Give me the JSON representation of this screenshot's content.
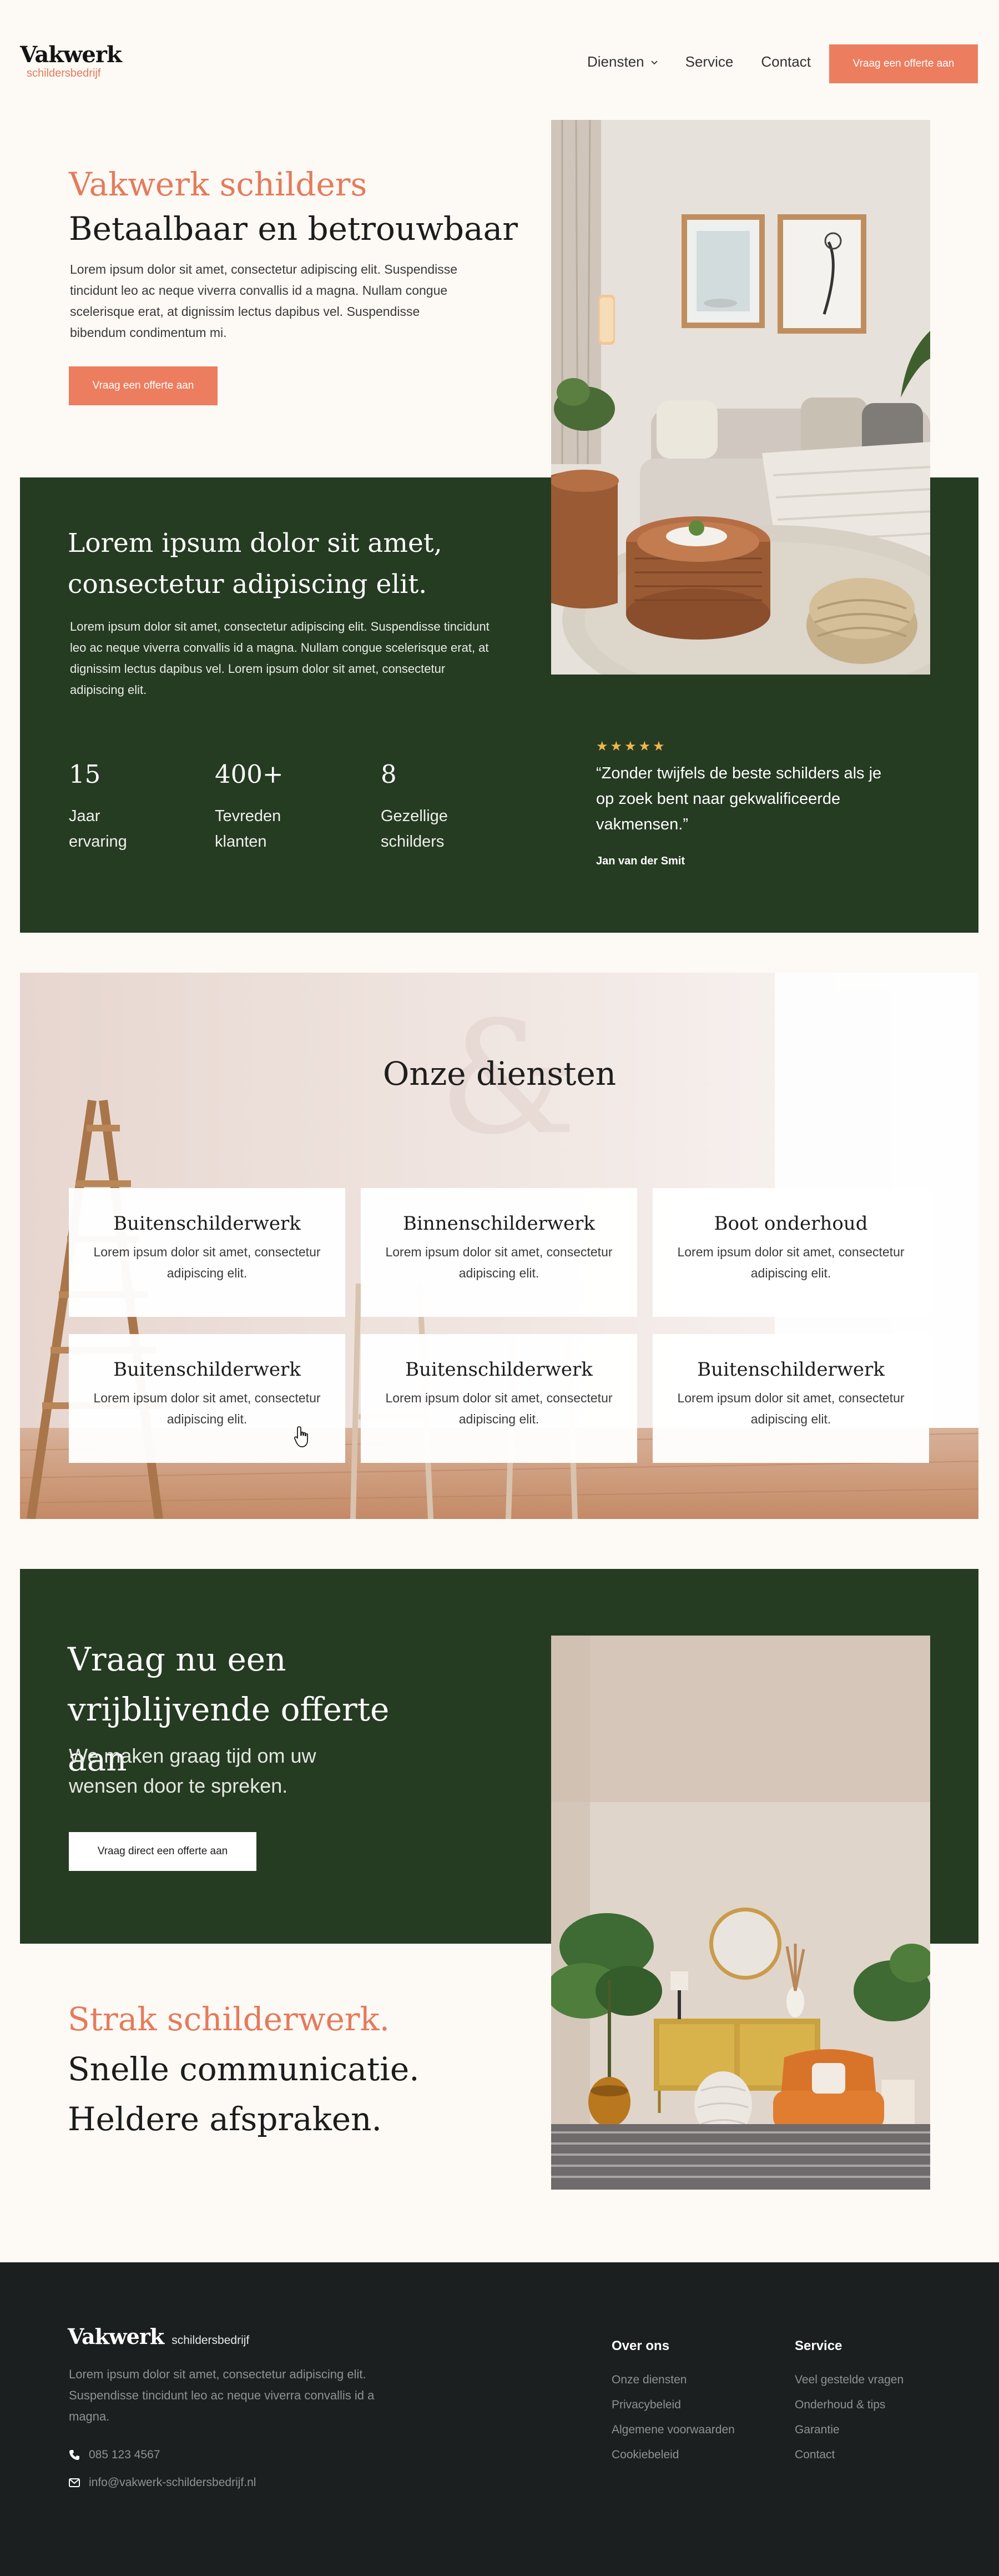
{
  "header": {
    "logo_main": "Vakwerk",
    "logo_sub": "schildersbedrijf",
    "nav": [
      {
        "label": "Diensten",
        "has_dropdown": true
      },
      {
        "label": "Service"
      },
      {
        "label": "Contact"
      }
    ],
    "cta_label": "Vraag een offerte aan"
  },
  "hero": {
    "title_accent": "Vakwerk schilders",
    "title_main": "Betaalbaar en betrouwbaar",
    "text": "Lorem ipsum dolor sit amet, consectetur adipiscing elit. Suspendisse tincidunt leo ac neque viverra convallis id a magna. Nullam congue scelerisque erat, at dignissim lectus dapibus vel. Suspendisse bibendum condimentum mi.",
    "button_label": "Vraag een offerte aan"
  },
  "about": {
    "title": "Lorem ipsum dolor sit amet, consectetur adipiscing elit.",
    "text": "Lorem ipsum dolor sit amet, consectetur adipiscing elit. Suspendisse tincidunt leo ac neque viverra convallis id a magna. Nullam congue scelerisque erat, at dignissim lectus dapibus vel.  Lorem ipsum dolor sit amet, consectetur adipiscing elit.",
    "stats": [
      {
        "value": "15",
        "label_1": "Jaar",
        "label_2": "ervaring"
      },
      {
        "value": "400+",
        "label_1": "Tevreden",
        "label_2": "klanten"
      },
      {
        "value": "8",
        "label_1": "Gezellige",
        "label_2": "schilders"
      }
    ],
    "rating_stars": "★★★★★",
    "quote": "“Zonder twijfels de beste schilders als je op zoek bent naar  gekwalificeerde vakmensen.”",
    "quote_author": "Jan van der Smit"
  },
  "services": {
    "title": "Onze diensten",
    "decor_glyph": "&",
    "cards": [
      {
        "title": "Buitenschilderwerk",
        "text": "Lorem ipsum dolor sit amet, consectetur adipiscing elit."
      },
      {
        "title": "Binnenschilderwerk",
        "text": "Lorem ipsum dolor sit amet, consectetur adipiscing elit."
      },
      {
        "title": "Boot onderhoud",
        "text": "Lorem ipsum dolor sit amet, consectetur adipiscing elit."
      },
      {
        "title": "Buitenschilderwerk",
        "text": "Lorem ipsum dolor sit amet, consectetur adipiscing elit."
      },
      {
        "title": "Buitenschilderwerk",
        "text": "Lorem ipsum dolor sit amet, consectetur adipiscing elit."
      },
      {
        "title": "Buitenschilderwerk",
        "text": "Lorem ipsum dolor sit amet, consectetur adipiscing elit."
      }
    ]
  },
  "offerte": {
    "title": "Vraag nu een vrijblijvende offerte aan",
    "subtitle": "We maken graag tijd om uw wensen door te spreken.",
    "button_label": "Vraag direct een offerte aan"
  },
  "tagline": {
    "line_accent": "Strak schilderwerk.",
    "line_2": "Snelle communicatie.",
    "line_3": "Heldere afspraken."
  },
  "footer": {
    "logo_main": "Vakwerk",
    "logo_sub": "schildersbedrijf",
    "text": "Lorem ipsum dolor sit amet, consectetur adipiscing elit. Suspendisse tincidunt leo ac neque viverra convallis id a magna.",
    "phone": "085 123 4567",
    "email": "info@vakwerk-schildersbedrijf.nl",
    "columns": [
      {
        "title": "Over ons",
        "links": [
          "Onze diensten",
          "Privacybeleid",
          "Algemene voorwaarden",
          "Cookiebeleid"
        ]
      },
      {
        "title": "Service",
        "links": [
          "Veel gestelde vragen",
          "Onderhoud & tips",
          "Garantie",
          "Contact"
        ]
      }
    ]
  },
  "colors": {
    "accent": "#ec7d5f",
    "dark_green": "#253b22",
    "footer_bg": "#1c1f1f",
    "page_bg": "#fdf9f4",
    "star": "#f1b64a"
  },
  "icons": [
    "chevron-down-icon",
    "phone-icon",
    "mail-icon",
    "star-icon",
    "hand-cursor-icon"
  ]
}
